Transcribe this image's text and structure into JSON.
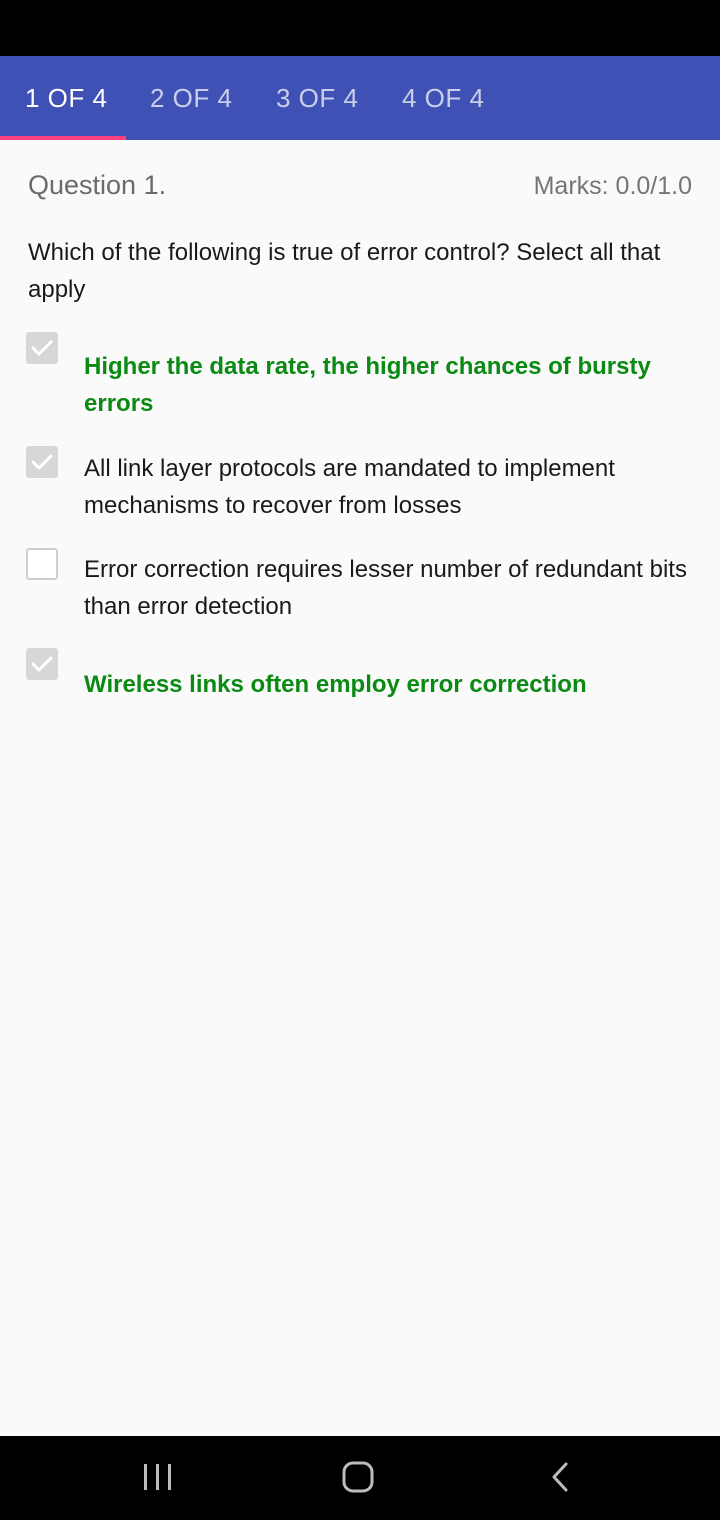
{
  "tabs": [
    {
      "label": "1 OF 4",
      "active": true
    },
    {
      "label": "2 OF 4",
      "active": false
    },
    {
      "label": "3 OF 4",
      "active": false
    },
    {
      "label": "4 OF 4",
      "active": false
    }
  ],
  "question": {
    "title": "Question 1.",
    "marks": "Marks: 0.0/1.0",
    "text": "Which of the following is true of error control? Select all that apply"
  },
  "options": [
    {
      "text": "Higher the data rate, the higher chances of bursty errors",
      "checked": true,
      "correct": true
    },
    {
      "text": "All link layer protocols are mandated to implement mechanisms to recover from losses",
      "checked": true,
      "correct": false
    },
    {
      "text": "Error correction requires lesser number of redundant bits than error detection",
      "checked": false,
      "correct": false
    },
    {
      "text": "Wireless links often employ error correction",
      "checked": true,
      "correct": true
    }
  ],
  "colors": {
    "tab_bar": "#3f51b5",
    "tab_indicator": "#ff4081",
    "correct_answer": "#0a8a12"
  },
  "nav": {
    "recents_icon": "recents-icon",
    "home_icon": "home-icon",
    "back_icon": "back-icon"
  }
}
